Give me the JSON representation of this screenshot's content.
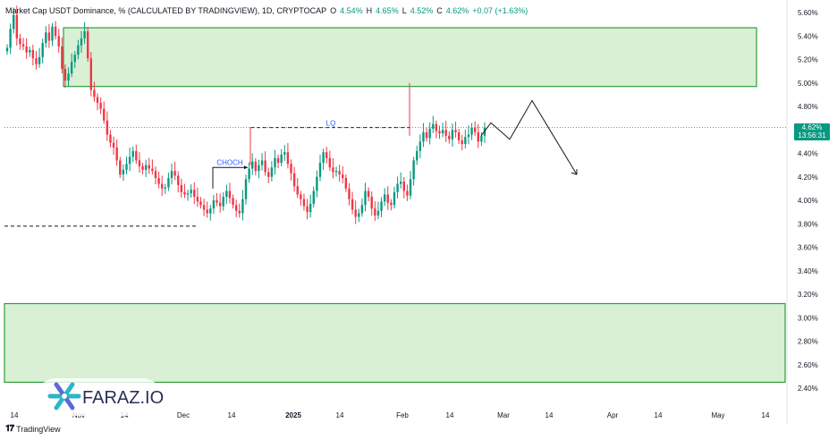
{
  "header": {
    "title": "Market Cap USDT Dominance, % (CALCULATED BY TRADINGVIEW), 1D, CRYPTOCAP",
    "open_label": "O",
    "open_value": "4.54%",
    "high_label": "H",
    "high_value": "4.65%",
    "low_label": "L",
    "low_value": "4.52%",
    "close_label": "C",
    "close_value": "4.62%",
    "change": "+0.07 (+1.63%)"
  },
  "price_tag": {
    "value": "4.62%",
    "countdown": "13:56:31"
  },
  "annotations": {
    "choch": "CHOCH",
    "lq": "LQ"
  },
  "watermark": {
    "brand": "FARAZ.IO"
  },
  "footer": {
    "brand": "TradingView"
  },
  "colors": {
    "up": "#089981",
    "down": "#f23645",
    "zone_fill": "#d9f0d5",
    "zone_stroke": "#2e9e3b",
    "annotation": "#2962ff"
  },
  "chart_data": {
    "type": "candlestick",
    "ylim": [
      2.4,
      5.6
    ],
    "y_ticks": [
      "5.60%",
      "5.40%",
      "5.20%",
      "5.00%",
      "4.80%",
      "4.60%",
      "4.40%",
      "4.20%",
      "4.00%",
      "3.80%",
      "3.60%",
      "3.40%",
      "3.20%",
      "3.00%",
      "2.80%",
      "2.60%",
      "2.40%"
    ],
    "x_ticks": [
      "14",
      "Nov",
      "14",
      "Dec",
      "14",
      "2025",
      "14",
      "Feb",
      "14",
      "Mar",
      "14",
      "Apr",
      "14",
      "May",
      "14"
    ],
    "supply_zone": [
      4.97,
      5.47
    ],
    "demand_zone": [
      2.45,
      3.12
    ],
    "lq_level": 4.62,
    "support_level": 3.78,
    "current_price": 4.62,
    "choch_level": 4.28,
    "projection": [
      4.55,
      4.66,
      4.52,
      4.85,
      4.22
    ],
    "closes": [
      5.3,
      5.46,
      5.58,
      5.38,
      5.33,
      5.31,
      5.26,
      5.28,
      5.21,
      5.16,
      5.22,
      5.34,
      5.43,
      5.36,
      5.48,
      5.4,
      5.31,
      5.12,
      5.02,
      5.08,
      5.18,
      5.24,
      5.32,
      5.38,
      5.44,
      5.21,
      4.94,
      4.88,
      4.83,
      4.78,
      4.68,
      4.56,
      4.49,
      4.45,
      4.34,
      4.22,
      4.26,
      4.31,
      4.37,
      4.42,
      4.34,
      4.29,
      4.26,
      4.3,
      4.27,
      4.25,
      4.19,
      4.14,
      4.1,
      4.11,
      4.19,
      4.25,
      4.21,
      4.13,
      4.07,
      4.05,
      4.06,
      4.09,
      4.03,
      3.99,
      3.96,
      3.92,
      3.89,
      3.93,
      4.0,
      3.98,
      3.95,
      4.03,
      4.08,
      4.02,
      3.96,
      3.91,
      3.89,
      4.01,
      4.18,
      4.27,
      4.33,
      4.25,
      4.3,
      4.34,
      4.24,
      4.2,
      4.28,
      4.36,
      4.32,
      4.39,
      4.41,
      4.31,
      4.23,
      4.12,
      4.05,
      4.01,
      3.95,
      3.9,
      3.97,
      4.08,
      4.2,
      4.32,
      4.41,
      4.36,
      4.28,
      4.24,
      4.25,
      4.22,
      4.19,
      4.1,
      4.01,
      3.92,
      3.86,
      3.89,
      3.96,
      4.08,
      4.03,
      3.93,
      3.87,
      3.91,
      3.99,
      4.05,
      3.98,
      3.96,
      4.07,
      4.14,
      4.16,
      4.08,
      4.04,
      4.18,
      4.34,
      4.42,
      4.5,
      4.58,
      4.53,
      4.61,
      4.65,
      4.59,
      4.57,
      4.6,
      4.55,
      4.52,
      4.6,
      4.58,
      4.51,
      4.48,
      4.54,
      4.56,
      4.62,
      4.58,
      4.5,
      4.55,
      4.62
    ]
  }
}
